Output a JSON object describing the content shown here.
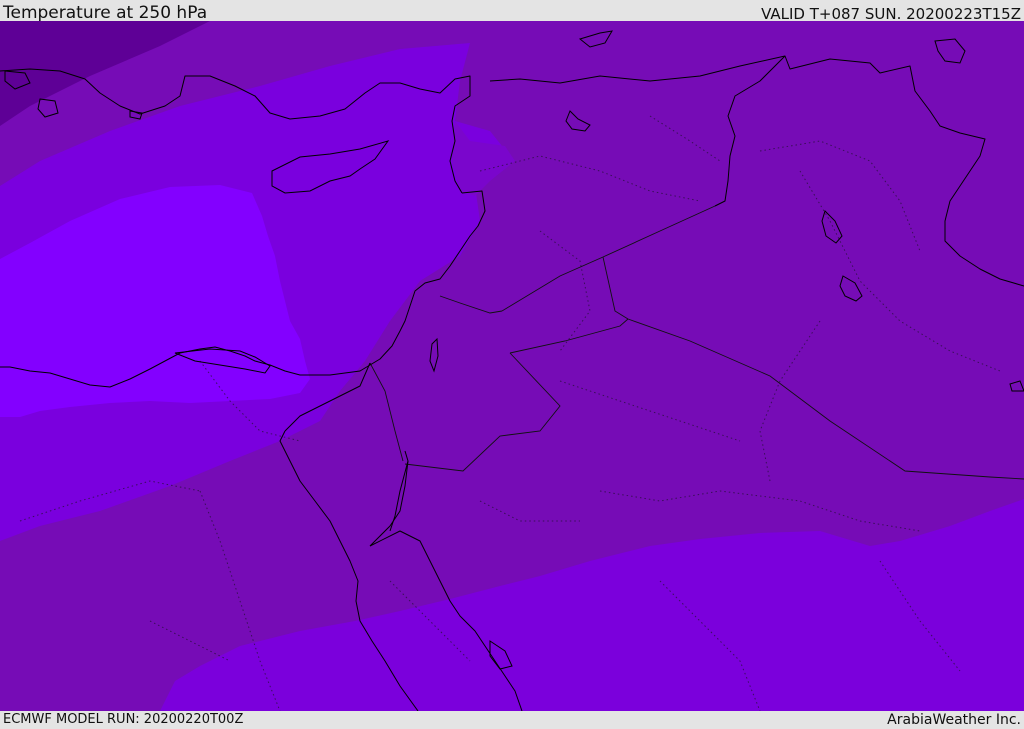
{
  "header": {
    "title": "Temperature at 250 hPa",
    "valid": "VALID T+087 SUN. 20200223T15Z"
  },
  "footer": {
    "model_run": "ECMWF MODEL RUN: 20200220T00Z",
    "credit": "ArabiaWeather Inc."
  },
  "map": {
    "parameter": "temperature",
    "level": "250 hPa",
    "colors": {
      "band_coldest": "#5e0096",
      "band_cold": "#720ab0",
      "band_mid": "#7b0fbf",
      "band_warm": "#8000e0",
      "band_warmest": "#8300ff",
      "coastline": "#000000",
      "border": "#111111"
    }
  }
}
